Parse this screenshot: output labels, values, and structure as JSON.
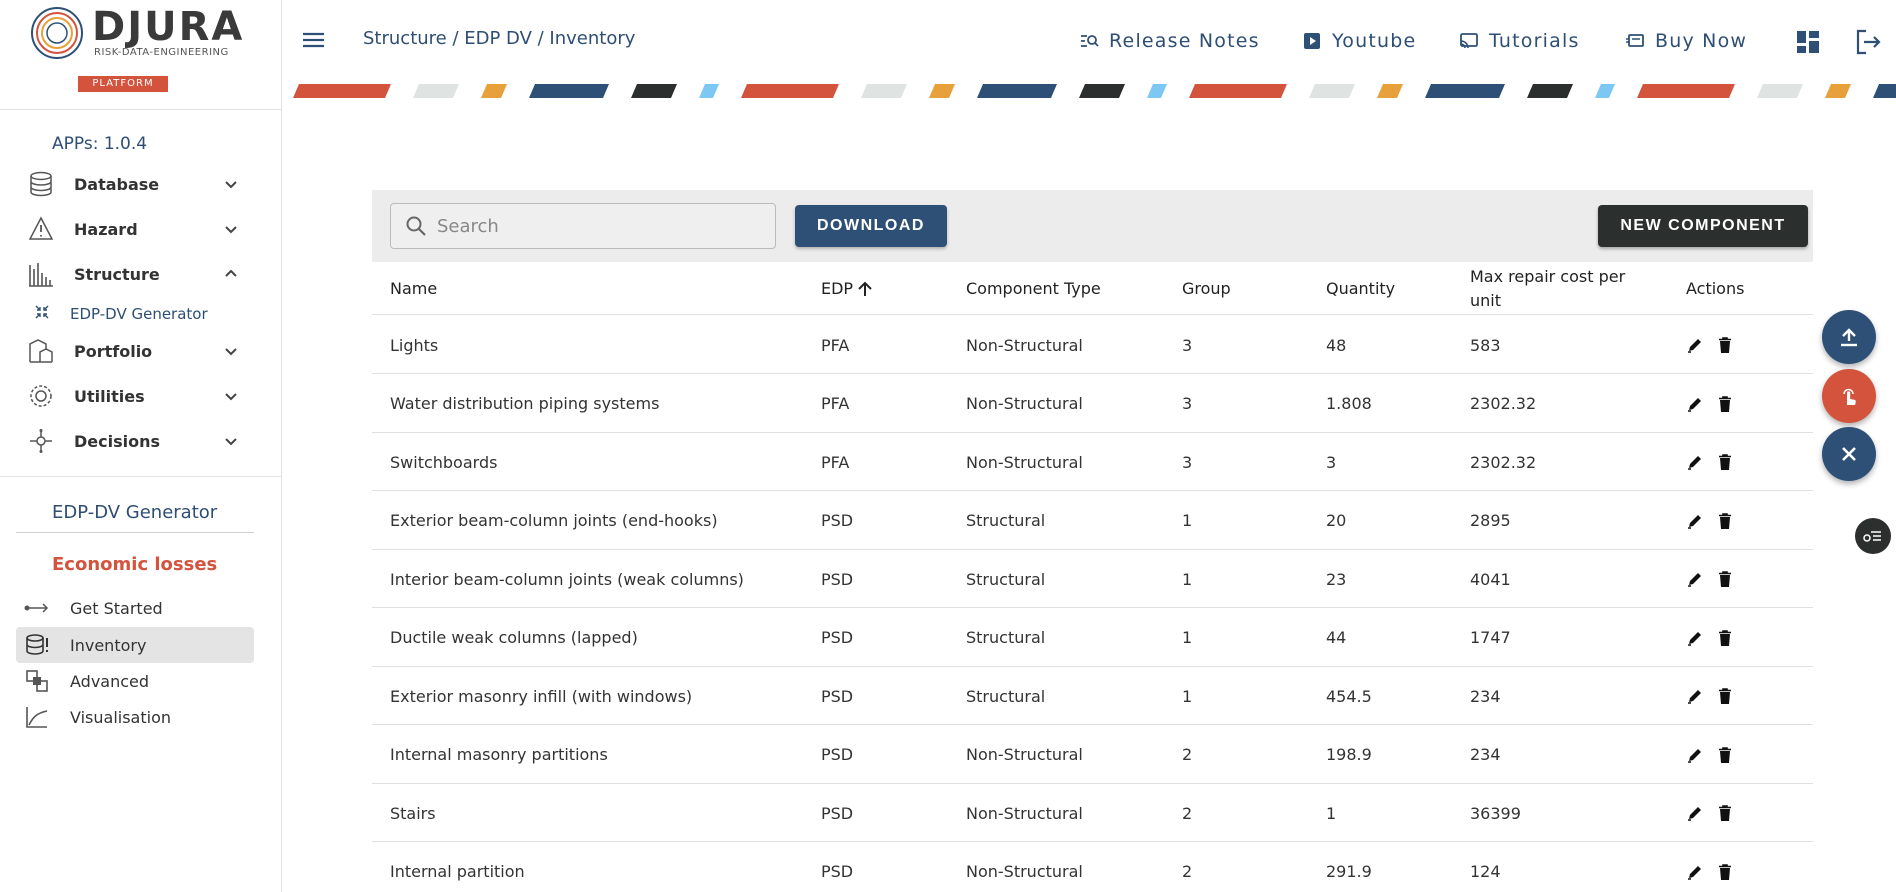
{
  "brand": {
    "name": "DJURA",
    "tagline": "RISK-DATA-ENGINEERING",
    "badge": "PLATFORM"
  },
  "sidebar": {
    "version": "APPs: 1.0.4",
    "items": [
      {
        "label": "Database",
        "icon": "database-icon",
        "expanded": false
      },
      {
        "label": "Hazard",
        "icon": "warning-icon",
        "expanded": false
      },
      {
        "label": "Structure",
        "icon": "buildings-icon",
        "expanded": true
      },
      {
        "label": "Portfolio",
        "icon": "portfolio-icon",
        "expanded": false
      },
      {
        "label": "Utilities",
        "icon": "gear-cluster-icon",
        "expanded": false
      },
      {
        "label": "Decisions",
        "icon": "decision-icon",
        "expanded": false
      }
    ],
    "subitem": {
      "label": "EDP-DV Generator",
      "icon": "compress-icon"
    },
    "section_title": "EDP-DV Generator",
    "subsection_title": "Economic losses",
    "steps": [
      {
        "label": "Get Started",
        "icon": "arrow-range-icon"
      },
      {
        "label": "Inventory",
        "icon": "database-alert-icon",
        "active": true
      },
      {
        "label": "Advanced",
        "icon": "layers-icon"
      },
      {
        "label": "Visualisation",
        "icon": "chart-line-icon"
      }
    ]
  },
  "header": {
    "breadcrumb": "Structure / EDP DV / Inventory",
    "links": [
      {
        "label": "Release Notes",
        "icon": "release-notes-icon"
      },
      {
        "label": "Youtube",
        "icon": "youtube-icon"
      },
      {
        "label": "Tutorials",
        "icon": "tutorials-icon"
      },
      {
        "label": "Buy Now",
        "icon": "buy-icon"
      }
    ]
  },
  "toolbar": {
    "search_placeholder": "Search",
    "download_label": "DOWNLOAD",
    "new_component_label": "NEW COMPONENT"
  },
  "table": {
    "columns": {
      "name": "Name",
      "edp": "EDP",
      "type": "Component Type",
      "group": "Group",
      "quantity": "Quantity",
      "cost": "Max repair cost per unit",
      "actions": "Actions"
    },
    "sort": {
      "column": "EDP",
      "direction": "ascending"
    },
    "rows": [
      {
        "name": "Lights",
        "edp": "PFA",
        "type": "Non-Structural",
        "group": "3",
        "quantity": "48",
        "cost": "583"
      },
      {
        "name": "Water distribution piping systems",
        "edp": "PFA",
        "type": "Non-Structural",
        "group": "3",
        "quantity": "1.808",
        "cost": "2302.32"
      },
      {
        "name": "Switchboards",
        "edp": "PFA",
        "type": "Non-Structural",
        "group": "3",
        "quantity": "3",
        "cost": "2302.32"
      },
      {
        "name": "Exterior beam-column joints (end-hooks)",
        "edp": "PSD",
        "type": "Structural",
        "group": "1",
        "quantity": "20",
        "cost": "2895"
      },
      {
        "name": "Interior beam-column joints (weak columns)",
        "edp": "PSD",
        "type": "Structural",
        "group": "1",
        "quantity": "23",
        "cost": "4041"
      },
      {
        "name": "Ductile weak columns (lapped)",
        "edp": "PSD",
        "type": "Structural",
        "group": "1",
        "quantity": "44",
        "cost": "1747"
      },
      {
        "name": "Exterior masonry infill (with windows)",
        "edp": "PSD",
        "type": "Structural",
        "group": "1",
        "quantity": "454.5",
        "cost": "234"
      },
      {
        "name": "Internal masonry partitions",
        "edp": "PSD",
        "type": "Non-Structural",
        "group": "2",
        "quantity": "198.9",
        "cost": "234"
      },
      {
        "name": "Stairs",
        "edp": "PSD",
        "type": "Non-Structural",
        "group": "2",
        "quantity": "1",
        "cost": "36399"
      },
      {
        "name": "Internal partition",
        "edp": "PSD",
        "type": "Non-Structural",
        "group": "2",
        "quantity": "291.9",
        "cost": "124"
      }
    ]
  },
  "colors": {
    "primary": "#2e5077",
    "accent": "#d4533d",
    "dark": "#2b2f2d",
    "stripe": [
      "#d4533d",
      "#dfe3e2",
      "#e8a03a",
      "#2e5077",
      "#2b2f2d",
      "#7cc8f2"
    ]
  }
}
